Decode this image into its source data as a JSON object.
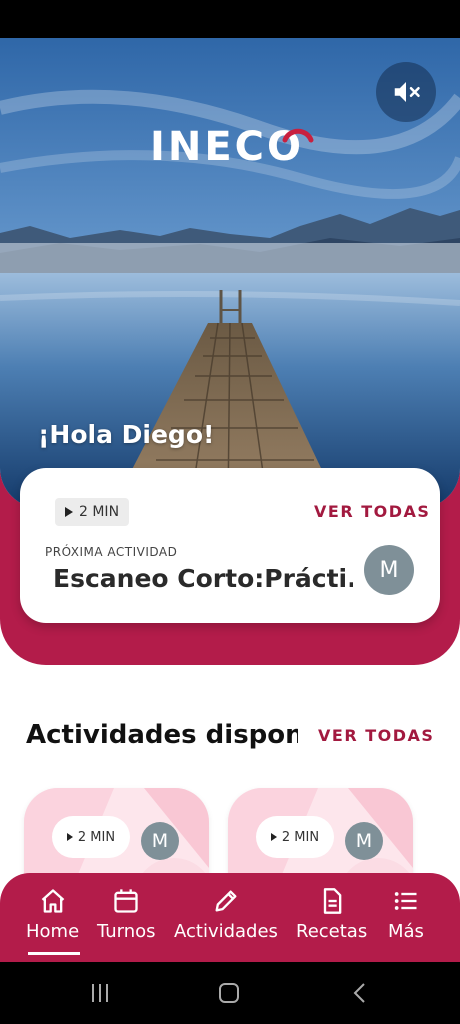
{
  "hero": {
    "logo_text": "INECO",
    "greeting": "¡Hola Diego!",
    "mute_icon": "volume-off-icon"
  },
  "next_activity": {
    "duration": "2 MIN",
    "see_all": "VER TODAS",
    "label": "PRÓXIMA ACTIVIDAD",
    "title": "Escaneo Corto:Prácti...",
    "avatar_letter": "M"
  },
  "available": {
    "title": "Actividades dispon...",
    "see_all": "VER TODAS",
    "cards": [
      {
        "duration": "2 MIN",
        "avatar_letter": "M"
      },
      {
        "duration": "2 MIN",
        "avatar_letter": "M"
      }
    ]
  },
  "bottom_nav": {
    "items": [
      {
        "label": "Home",
        "icon": "home-icon",
        "active": true
      },
      {
        "label": "Turnos",
        "icon": "calendar-icon",
        "active": false
      },
      {
        "label": "Actividades",
        "icon": "pencil-icon",
        "active": false
      },
      {
        "label": "Recetas",
        "icon": "document-icon",
        "active": false
      },
      {
        "label": "Más",
        "icon": "list-icon",
        "active": false
      }
    ]
  },
  "colors": {
    "brand": "#b31c4a",
    "accent_text": "#a2193f",
    "avatar": "#7f9098"
  }
}
